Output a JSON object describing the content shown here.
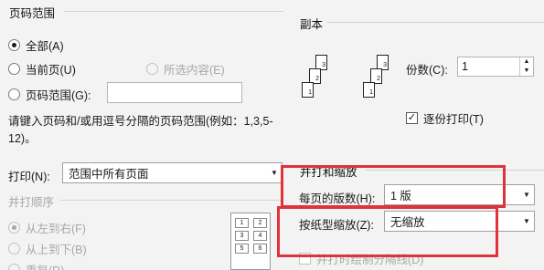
{
  "page_range": {
    "title": "页码范围",
    "all_label": "全部(A)",
    "current_label": "当前页(U)",
    "selected_label": "所选内容(E)",
    "pages_label": "页码范围(G):",
    "pages_value": "",
    "hint": "请键入页码和/或用逗号分隔的页码范围(例如：1,3,5-12)。"
  },
  "copies": {
    "title": "副本",
    "count_label": "份数(C):",
    "count_value": "1",
    "collate_label": "逐份打印(T)",
    "collate_checked": true
  },
  "print_what": {
    "label": "打印(N):",
    "value": "范围中所有页面"
  },
  "zoom": {
    "title": "并打和缩放",
    "pages_per_sheet_label": "每页的版数(H):",
    "pages_per_sheet_value": "1 版",
    "scale_label": "按纸型缩放(Z):",
    "scale_value": "无缩放",
    "partial_checkbox_label": "并打时绘制分隔线(D)"
  },
  "order": {
    "title": "并打顺序",
    "left_to_right": "从左到右(F)",
    "top_to_bottom": "从上到下(B)",
    "repeat": "重复(R)"
  }
}
